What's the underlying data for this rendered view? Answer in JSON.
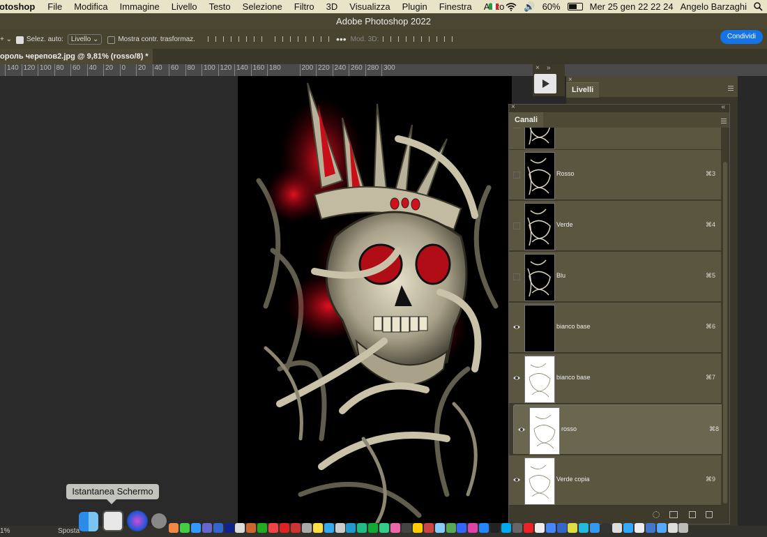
{
  "menubar": {
    "app": "otoshop",
    "items": [
      "File",
      "Modifica",
      "Immagine",
      "Livello",
      "Testo",
      "Selezione",
      "Filtro",
      "3D",
      "Visualizza",
      "Plugin",
      "Finestra",
      "Aiuto"
    ],
    "battery": "60%",
    "datetime": "Mer 25 gen  22 22 24",
    "user": "Angelo Barzaghi"
  },
  "titlebar": {
    "title": "Adobe Photoshop 2022"
  },
  "options": {
    "auto_select_label": "Selez. auto:",
    "auto_select_value": "Livello",
    "transform_label": "Mostra contr. trasformaz.",
    "mode3d_label": "Mod. 3D:",
    "share_label": "Condividi"
  },
  "document": {
    "tab_title": "ороль черепов2.jpg @ 9,81% (rosso/8) *"
  },
  "ruler": {
    "ticks": [
      "140",
      "120",
      "100",
      "80",
      "60",
      "40",
      "20",
      "0",
      "20",
      "40",
      "60",
      "80",
      "100",
      "120",
      "140",
      "160",
      "180",
      "200",
      "220",
      "240",
      "260",
      "280",
      "300"
    ]
  },
  "panels": {
    "livelli_title": "Livelli",
    "canali_title": "Canali",
    "channels": [
      {
        "name": "",
        "shortcut": "",
        "visible": false,
        "thumb": "dark"
      },
      {
        "name": "Rosso",
        "shortcut": "⌘3",
        "visible": false,
        "thumb": "dark"
      },
      {
        "name": "Verde",
        "shortcut": "⌘4",
        "visible": false,
        "thumb": "dark"
      },
      {
        "name": "Blu",
        "shortcut": "⌘5",
        "visible": false,
        "thumb": "dark"
      },
      {
        "name": "bianco base",
        "shortcut": "⌘6",
        "visible": true,
        "thumb": "black"
      },
      {
        "name": "bianco base",
        "shortcut": "⌘7",
        "visible": true,
        "thumb": "white"
      },
      {
        "name": "rosso",
        "shortcut": "⌘8",
        "visible": true,
        "thumb": "white",
        "selected": true
      },
      {
        "name": "Verde copia",
        "shortcut": "⌘9",
        "visible": true,
        "thumb": "white"
      }
    ]
  },
  "tooltip": "Istantanea Schermo",
  "status": {
    "zoom": "1%",
    "tool": "Sposta"
  },
  "colors": {
    "accent": "#1473e6",
    "panel": "#5a5640",
    "red": "#d0101a"
  }
}
